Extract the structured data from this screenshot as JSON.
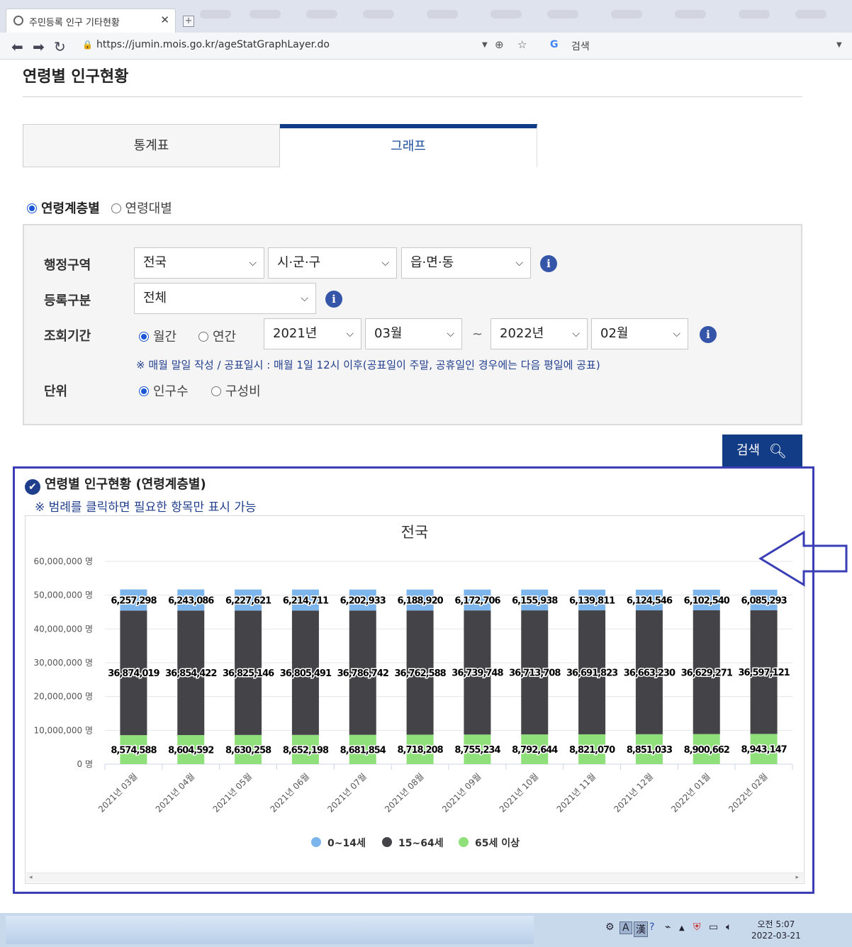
{
  "browser": {
    "tab_title": "주민등록 인구 기타현황",
    "tab_close": "✕",
    "url": "https://jumin.mois.go.kr/ageStatGraphLayer.do",
    "search_label": "검색",
    "google_glyph": "G"
  },
  "page": {
    "title": "연령별 인구현황",
    "tabs": [
      "통계표",
      "그래프"
    ],
    "view_options": [
      "연령계층별",
      "연령대별"
    ]
  },
  "form": {
    "region_label": "행정구역",
    "region_values": [
      "전국",
      "시·군·구",
      "읍·면·동"
    ],
    "reg_type_label": "등록구분",
    "reg_type_value": "전체",
    "period_label": "조회기간",
    "period_options": [
      "월간",
      "연간"
    ],
    "from_year": "2021년",
    "from_month": "03월",
    "tilde": "~",
    "to_year": "2022년",
    "to_month": "02월",
    "note": "※ 매월 말일 작성 / 공표일시 : 매월 1일 12시 이후(공표일이 주말, 공휴일인 경우에는 다음 평일에 공표)",
    "unit_label": "단위",
    "unit_options": [
      "인구수",
      "구성비"
    ],
    "search_button": "검색",
    "info_glyph": "i"
  },
  "panel": {
    "heading": "연령별 인구현황 (연령계층별)",
    "hint": "※ 범례를 클릭하면 필요한 항목만 표시 가능"
  },
  "chart_data": {
    "type": "bar",
    "stacked": true,
    "title": "전국",
    "y_unit": "명",
    "ylim": [
      0,
      60000000
    ],
    "y_ticks": [
      "60,000,000 명",
      "50,000,000 명",
      "40,000,000 명",
      "30,000,000 명",
      "20,000,000 명",
      "10,000,000 명",
      "0 명"
    ],
    "categories": [
      "2021년 03월",
      "2021년 04월",
      "2021년 05월",
      "2021년 06월",
      "2021년 07월",
      "2021년 08월",
      "2021년 09월",
      "2021년 10월",
      "2021년 11월",
      "2021년 12월",
      "2022년 01월",
      "2022년 02월"
    ],
    "series": [
      {
        "name": "65세 이상",
        "color": "#8fe07a",
        "values": [
          8574588,
          8604592,
          8630258,
          8652198,
          8681854,
          8718208,
          8755234,
          8792644,
          8821070,
          8851033,
          8900662,
          8943147
        ]
      },
      {
        "name": "15~64세",
        "color": "#434348",
        "values": [
          36874019,
          36854422,
          36825146,
          36805491,
          36786742,
          36762588,
          36739748,
          36713708,
          36691823,
          36663230,
          36629271,
          36597121
        ]
      },
      {
        "name": "0~14세",
        "color": "#7cb5ec",
        "values": [
          6257298,
          6243086,
          6227621,
          6214711,
          6202933,
          6188920,
          6172706,
          6155938,
          6139811,
          6124546,
          6102540,
          6085293
        ]
      }
    ],
    "legend_order": [
      "0~14세",
      "15~64세",
      "65세 이상"
    ],
    "legend_placement": "bottom-center",
    "grid": true
  },
  "taskbar": {
    "clock_time": "오전 5:07",
    "clock_date": "2022-03-21",
    "ime_a": "A",
    "ime_han": "漢"
  }
}
